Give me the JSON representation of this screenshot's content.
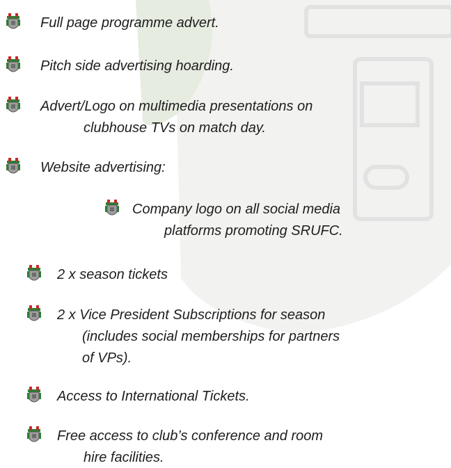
{
  "items": [
    {
      "lines": [
        "Full page programme advert."
      ]
    },
    {
      "lines": [
        "Pitch side advertising hoarding."
      ]
    },
    {
      "lines": [
        "Advert/Logo on multimedia presentations on",
        "clubhouse TVs on match day."
      ]
    },
    {
      "lines": [
        "Website advertising:"
      ]
    },
    {
      "lines": [
        "Company logo on all social media",
        "platforms promoting SRUFC."
      ]
    },
    {
      "lines": [
        "2 x season tickets"
      ]
    },
    {
      "lines": [
        "2 x Vice President Subscriptions for season",
        "(includes social memberships for partners",
        "of VPs)."
      ]
    },
    {
      "lines": [
        "Access to International Tickets."
      ]
    },
    {
      "lines": [
        "Free access to club’s conference and room",
        "hire facilities."
      ]
    }
  ],
  "icon_name": "club-crest-icon"
}
